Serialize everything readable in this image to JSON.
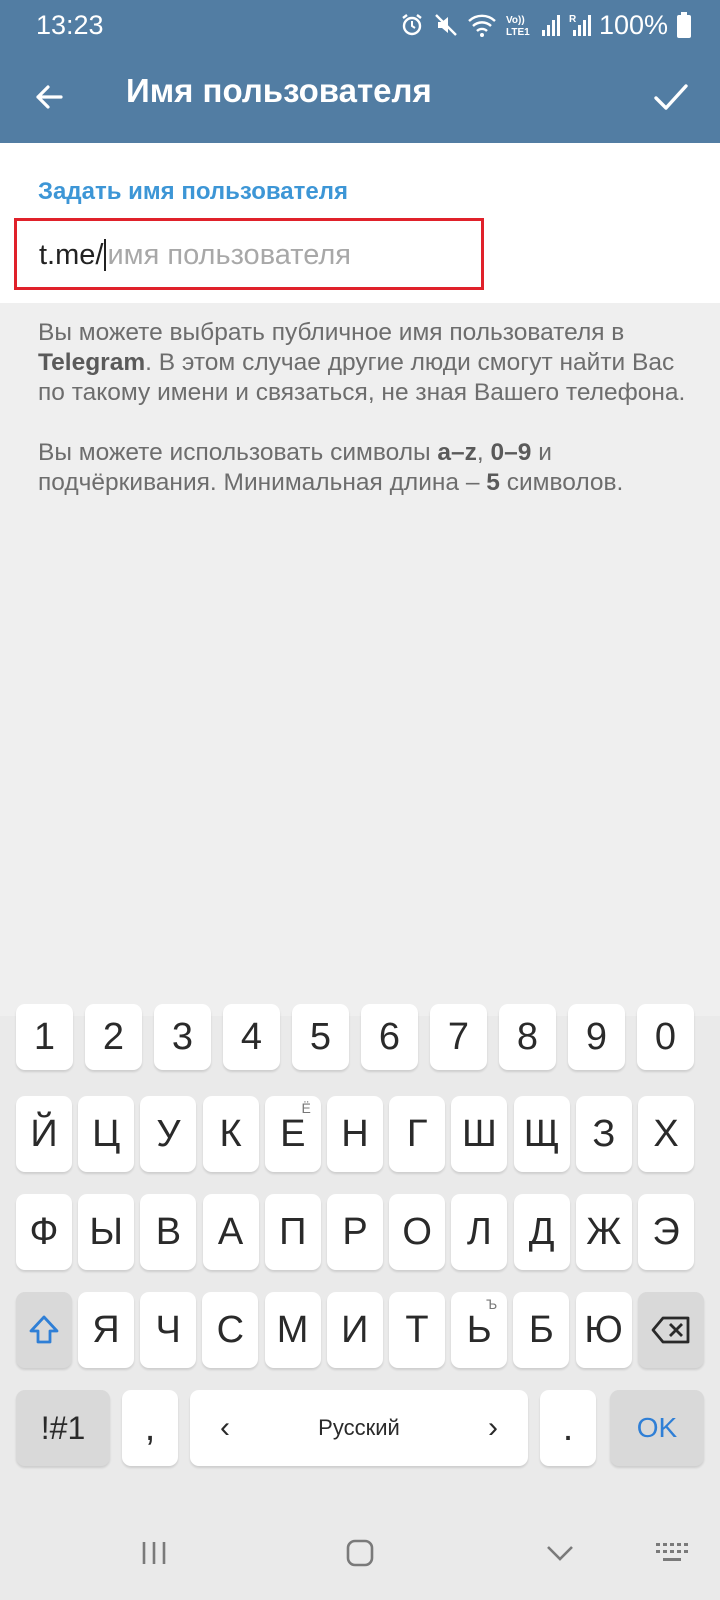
{
  "status_bar": {
    "time": "13:23",
    "battery": "100%",
    "icons": [
      "alarm-icon",
      "mute-icon",
      "wifi-icon",
      "volte-icon",
      "signal-icon",
      "signal-roaming-icon",
      "battery-icon"
    ],
    "volte_label": "Vo)) LTE1",
    "roaming_label": "R"
  },
  "app_bar": {
    "title": "Имя пользователя",
    "back_icon": "arrow-back-icon",
    "done_icon": "checkmark-icon"
  },
  "form": {
    "section_label": "Задать имя пользователя",
    "input_prefix": "t.me/",
    "input_value": "",
    "input_placeholder": "имя пользователя"
  },
  "info": {
    "p1_a": "Вы можете выбрать публичное имя пользователя в ",
    "p1_bold": "Telegram",
    "p1_b": ". В этом случае другие люди смогут найти Вас по такому имени и связаться, не зная Вашего телефона.",
    "p2_a": "Вы можете использовать символы ",
    "p2_bold1": "a–z",
    "p2_sep": ", ",
    "p2_bold2": "0–9",
    "p2_b": " и подчёркивания. Минимальная длина – ",
    "p2_bold3": "5",
    "p2_c": " символов."
  },
  "keyboard": {
    "row_numbers": [
      "1",
      "2",
      "3",
      "4",
      "5",
      "6",
      "7",
      "8",
      "9",
      "0"
    ],
    "row1": [
      "Й",
      "Ц",
      "У",
      "К",
      "Е",
      "Н",
      "Г",
      "Ш",
      "Щ",
      "З",
      "Х"
    ],
    "row1_hint_e": "Ё",
    "row2": [
      "Ф",
      "Ы",
      "В",
      "А",
      "П",
      "Р",
      "О",
      "Л",
      "Д",
      "Ж",
      "Э"
    ],
    "row3": [
      "Я",
      "Ч",
      "С",
      "М",
      "И",
      "Т",
      "Ь",
      "Б",
      "Ю"
    ],
    "row3_hint_soft": "Ъ",
    "symbols_label": "!#1",
    "comma_label": ",",
    "space_label": "Русский",
    "space_left": "‹",
    "space_right": "›",
    "period_label": ".",
    "ok_label": "OK",
    "shift_icon": "shift-icon",
    "backspace_icon": "backspace-icon"
  },
  "nav_bar": {
    "recents_icon": "recents-icon",
    "home_icon": "home-icon",
    "hide_keyboard_icon": "chevron-down-icon",
    "keyboard_switch_icon": "keyboard-icon"
  },
  "colors": {
    "header": "#527da3",
    "accent": "#3d96d6",
    "highlight_box": "#e0212a",
    "ok": "#2f7fd6"
  }
}
